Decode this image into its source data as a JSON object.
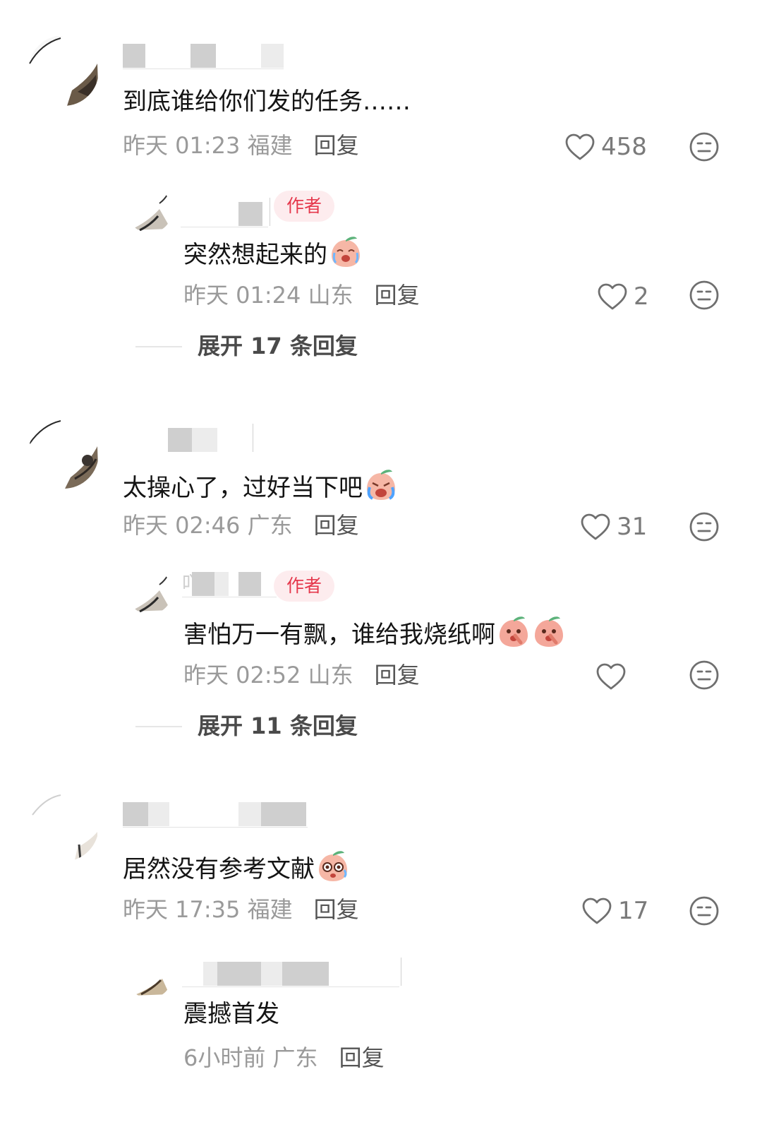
{
  "comments": [
    {
      "text": "到底谁给你们发的任务……",
      "time": "昨天 01:23",
      "location": "福建",
      "reply_label": "回复",
      "likes": "458",
      "reply": {
        "badge": "作者",
        "text": "突然想起来的",
        "time": "昨天 01:24",
        "location": "山东",
        "reply_label": "回复",
        "likes": "2"
      },
      "expand": "展开 17 条回复"
    },
    {
      "text": "太操心了，过好当下吧",
      "time": "昨天 02:46",
      "location": "广东",
      "reply_label": "回复",
      "likes": "31",
      "reply": {
        "badge": "作者",
        "name_partial": "吖",
        "text": "害怕万一有飘，谁给我烧纸啊",
        "time": "昨天 02:52",
        "location": "山东",
        "reply_label": "回复",
        "likes": ""
      },
      "expand": "展开 11 条回复"
    },
    {
      "text": "居然没有参考文献",
      "time": "昨天 17:35",
      "location": "福建",
      "reply_label": "回复",
      "likes": "17",
      "reply": {
        "text": "震撼首发",
        "time": "6小时前",
        "location": "广东",
        "reply_label": "回复"
      }
    }
  ],
  "icons": {
    "like": "heart-outline-icon",
    "dislike": "meh-face-icon",
    "emoji": "peach-emoji-icon"
  },
  "colors": {
    "text": "#141414",
    "meta": "#9a9a9a",
    "badge_bg": "#fdecee",
    "badge_text": "#e5384c"
  }
}
